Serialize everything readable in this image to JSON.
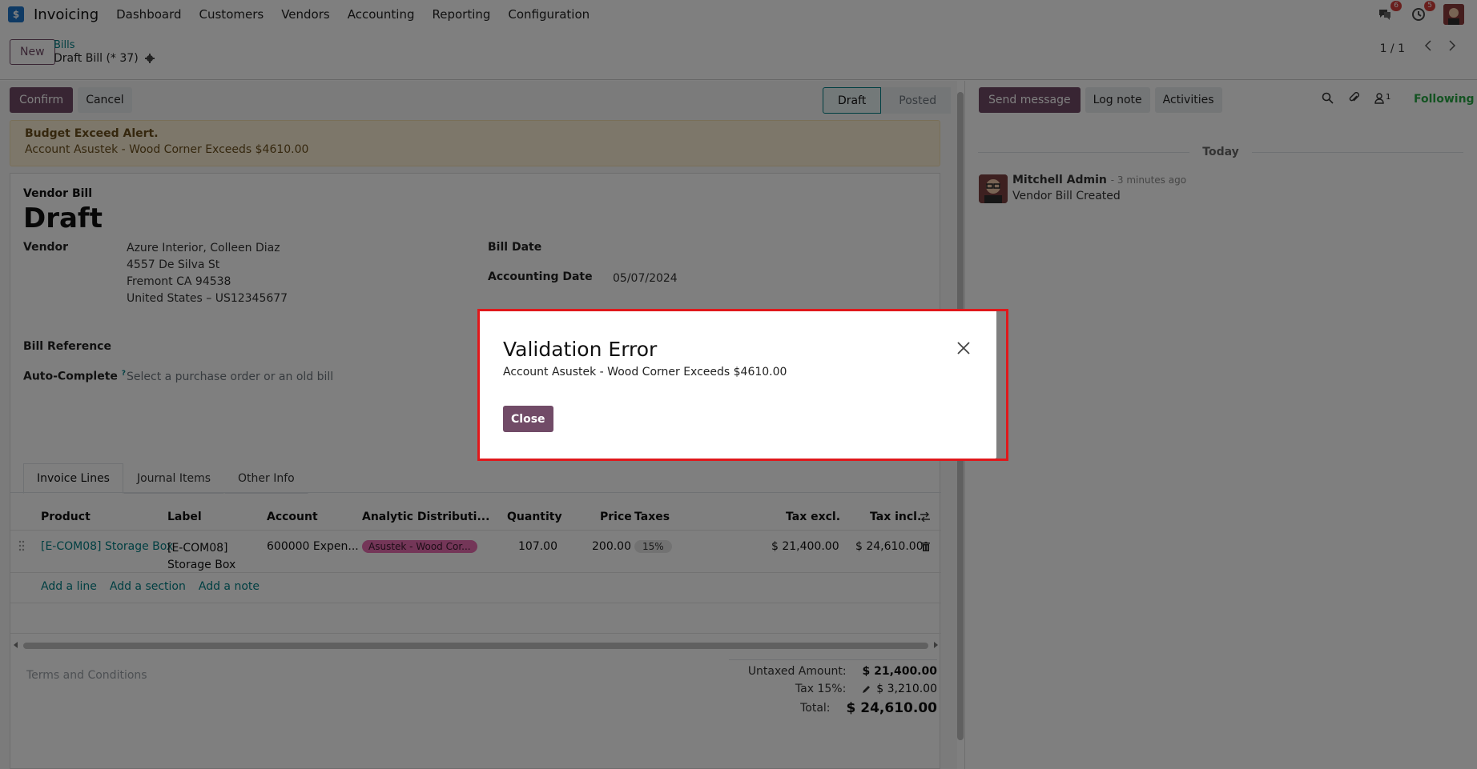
{
  "nav": {
    "app_name": "Invoicing",
    "menu": [
      "Dashboard",
      "Customers",
      "Vendors",
      "Accounting",
      "Reporting",
      "Configuration"
    ],
    "messages_badge": "6",
    "activities_badge": "5"
  },
  "control_panel": {
    "new_label": "New",
    "breadcrumb_parent": "Bills",
    "breadcrumb_current": "Draft Bill (* 37)",
    "pager": "1 / 1"
  },
  "actions": {
    "confirm": "Confirm",
    "cancel": "Cancel"
  },
  "status": {
    "draft": "Draft",
    "posted": "Posted"
  },
  "alert": {
    "title": "Budget Exceed Alert.",
    "message": "Account Asustek - Wood Corner Exceeds $4610.00"
  },
  "form": {
    "doc_type": "Vendor Bill",
    "title": "Draft",
    "vendor_label": "Vendor",
    "vendor_lines": [
      "Azure Interior, Colleen Diaz",
      "4557 De Silva St",
      "Fremont CA 94538",
      "United States – US12345677"
    ],
    "bill_reference_label": "Bill Reference",
    "auto_complete_label": "Auto-Complete",
    "auto_complete_help": "?",
    "auto_complete_placeholder": "Select a purchase order or an old bill",
    "bill_date_label": "Bill Date",
    "accounting_date_label": "Accounting Date",
    "accounting_date": "05/07/2024"
  },
  "tabs": [
    "Invoice Lines",
    "Journal Items",
    "Other Info"
  ],
  "lines": {
    "headers": [
      "Product",
      "Label",
      "Account",
      "Analytic Distributi...",
      "Quantity",
      "Price",
      "Taxes",
      "Tax excl.",
      "Tax incl."
    ],
    "rows": [
      {
        "product": "[E-COM08] Storage Box",
        "label_1": "[E-COM08]",
        "label_2": "Storage Box",
        "account": "600000 Expen...",
        "analytic": "Asustek - Wood Cor...",
        "quantity": "107.00",
        "price": "200.00",
        "taxes": "15%",
        "tax_excl": "$ 21,400.00",
        "tax_incl": "$ 24,610.00"
      }
    ],
    "add_line": "Add a line",
    "add_section": "Add a section",
    "add_note": "Add a note"
  },
  "terms_placeholder": "Terms and Conditions",
  "totals": {
    "untaxed_label": "Untaxed Amount:",
    "untaxed": "$ 21,400.00",
    "tax_label": "Tax 15%:",
    "tax": "$ 3,210.00",
    "total_label": "Total:",
    "total": "$ 24,610.00"
  },
  "chatter": {
    "send_message": "Send message",
    "log_note": "Log note",
    "activities": "Activities",
    "followers_count": "1",
    "following": "Following",
    "today": "Today",
    "author": "Mitchell Admin",
    "time": "- 3 minutes ago",
    "body": "Vendor Bill Created"
  },
  "modal": {
    "title": "Validation Error",
    "message": "Account Asustek - Wood Corner Exceeds $4610.00",
    "close_label": "Close"
  },
  "colors": {
    "brand": "#714b67",
    "link": "#017e84",
    "highlight": "#e0181b"
  }
}
